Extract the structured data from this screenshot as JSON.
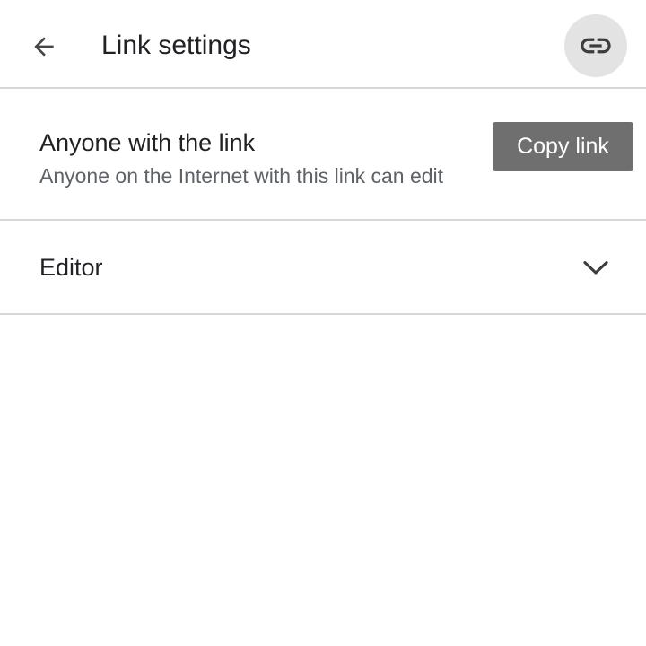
{
  "header": {
    "title": "Link settings",
    "back_icon": "arrow-back-icon",
    "link_icon": "link-icon"
  },
  "access": {
    "title": "Anyone with the link",
    "subtitle": "Anyone on the Internet with this link can edit",
    "edit_icon": "pencil-icon"
  },
  "tooltip": {
    "label": "Copy link"
  },
  "role": {
    "selected": "Editor",
    "dropdown_icon": "chevron-down-icon"
  },
  "colors": {
    "text_primary": "#202124",
    "text_secondary": "#5f6368",
    "divider": "#d7d7d7",
    "link_button_bg": "#e3e3e3",
    "tooltip_bg": "#6f6f6f"
  }
}
